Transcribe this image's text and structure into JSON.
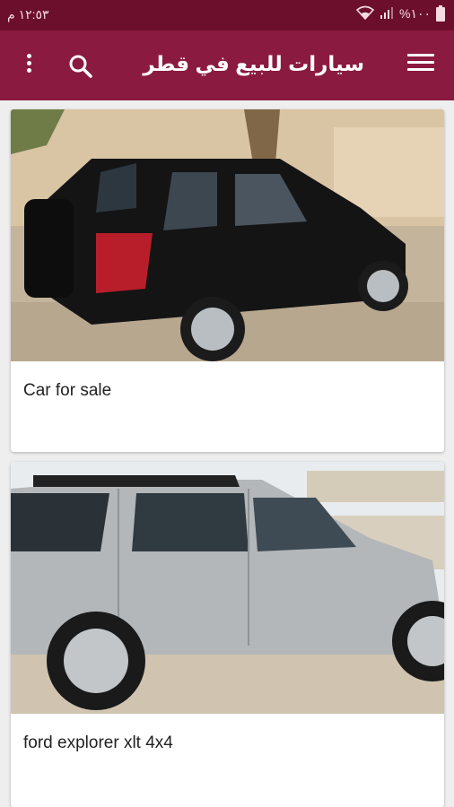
{
  "status_bar": {
    "time": "١٢:٥٣ م",
    "battery": "%١٠٠",
    "signal_icon": "signal-icon",
    "wifi_icon": "wifi-icon",
    "battery_icon": "battery-icon"
  },
  "app_bar": {
    "title": "سيارات للبيع في قطر",
    "menu_icon": "hamburger-menu-icon",
    "search_icon": "search-icon",
    "more_icon": "more-vertical-icon"
  },
  "colors": {
    "status_bar": "#6b0f2c",
    "app_bar": "#8b1a40",
    "background": "#eeeeee"
  },
  "listings": [
    {
      "title": "Car for sale",
      "image": "black-suv-photo"
    },
    {
      "title": "ford explorer xlt 4x4",
      "image": "silver-suv-photo"
    }
  ]
}
